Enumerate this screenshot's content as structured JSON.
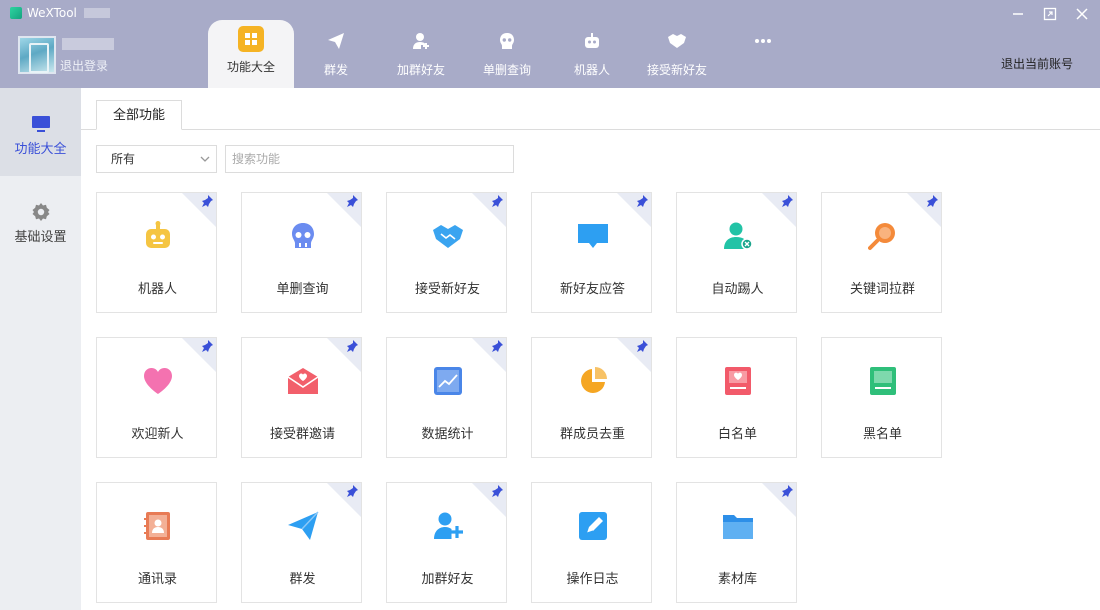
{
  "app": {
    "title": "WeXTool"
  },
  "user": {
    "logout_label": "退出登录"
  },
  "top_tabs": [
    {
      "label": "功能大全",
      "icon": "grid-icon",
      "active": true
    },
    {
      "label": "群发",
      "icon": "send-icon"
    },
    {
      "label": "加群好友",
      "icon": "add-friend-icon"
    },
    {
      "label": "单删查询",
      "icon": "skull-icon"
    },
    {
      "label": "机器人",
      "icon": "robot-icon"
    },
    {
      "label": "接受新好友",
      "icon": "handshake-icon"
    },
    {
      "label": "",
      "icon": "more-icon"
    }
  ],
  "exit_account_label": "退出当前账号",
  "sidebar": [
    {
      "label": "功能大全",
      "icon": "monitor-icon",
      "active": true
    },
    {
      "label": "基础设置",
      "icon": "gear-icon"
    }
  ],
  "main": {
    "tab_label": "全部功能",
    "filter_value": "所有",
    "search_placeholder": "搜索功能"
  },
  "features": [
    {
      "label": "机器人",
      "icon": "robot-icon",
      "color": "#f5c542",
      "pinned": true
    },
    {
      "label": "单删查询",
      "icon": "skull-icon",
      "color": "#6b8cf0",
      "pinned": true
    },
    {
      "label": "接受新好友",
      "icon": "handshake-icon",
      "color": "#3aa4f0",
      "pinned": true
    },
    {
      "label": "新好友应答",
      "icon": "chat-bubble-icon",
      "color": "#2d9ff2",
      "pinned": true
    },
    {
      "label": "自动踢人",
      "icon": "user-remove-icon",
      "color": "#22c3a6",
      "pinned": true
    },
    {
      "label": "关键词拉群",
      "icon": "search-icon",
      "color": "#f48a3a",
      "pinned": true
    },
    {
      "label": "欢迎新人",
      "icon": "heart-icon",
      "color": "#f264a0",
      "pinned": true
    },
    {
      "label": "接受群邀请",
      "icon": "envelope-icon",
      "color": "#f25f6b",
      "pinned": true
    },
    {
      "label": "数据统计",
      "icon": "chart-icon",
      "color": "#4a86e8",
      "pinned": true
    },
    {
      "label": "群成员去重",
      "icon": "pie-icon",
      "color": "#f5a623",
      "pinned": true
    },
    {
      "label": "白名单",
      "icon": "whitelist-icon",
      "color": "#f25a6a",
      "pinned": false
    },
    {
      "label": "黑名单",
      "icon": "blacklist-icon",
      "color": "#2fbf7a",
      "pinned": false
    },
    {
      "label": "通讯录",
      "icon": "contacts-icon",
      "color": "#e87b55",
      "pinned": false
    },
    {
      "label": "群发",
      "icon": "send-icon",
      "color": "#2d9ff2",
      "pinned": true
    },
    {
      "label": "加群好友",
      "icon": "add-friend-icon",
      "color": "#2d9ff2",
      "pinned": true
    },
    {
      "label": "操作日志",
      "icon": "edit-log-icon",
      "color": "#2d9ff2",
      "pinned": false
    },
    {
      "label": "素材库",
      "icon": "folder-icon",
      "color": "#3aa4f0",
      "pinned": true
    }
  ]
}
